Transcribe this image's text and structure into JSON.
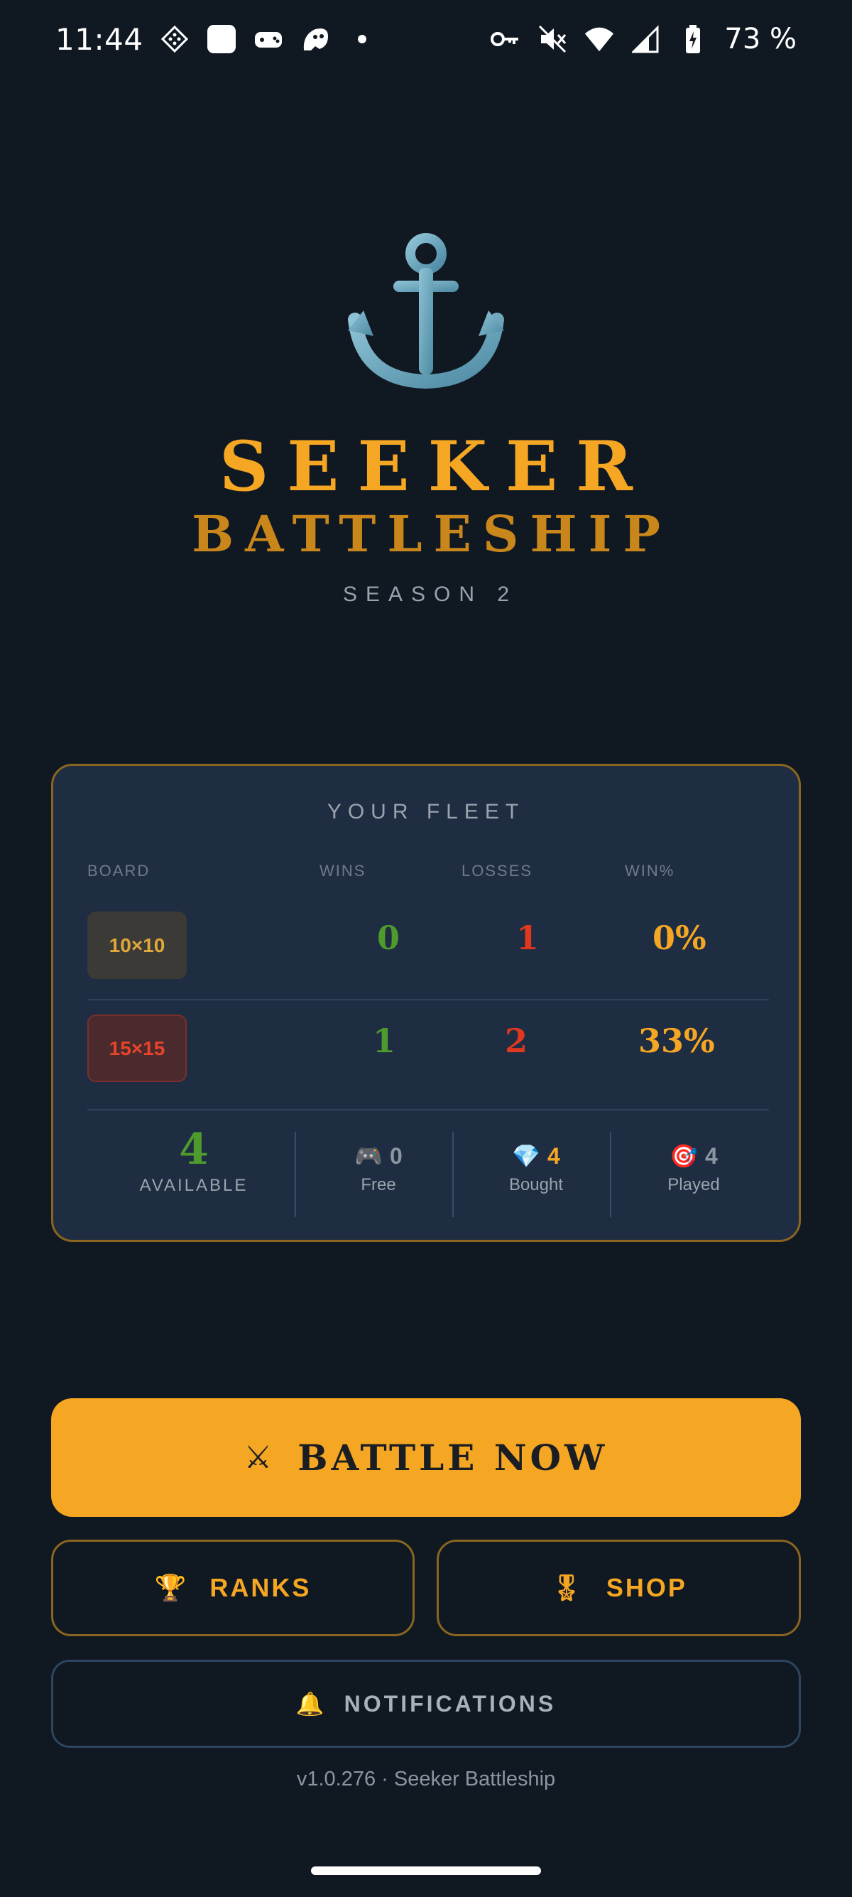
{
  "status_bar": {
    "time": "11:44",
    "battery": "73 %",
    "icons": [
      "diamond-grid-icon",
      "white-square-icon",
      "game-controller-icon",
      "ghost-icon",
      "dot-icon",
      "vpn-key-icon",
      "mute-icon",
      "wifi-icon",
      "signal-icon",
      "battery-icon"
    ]
  },
  "hero": {
    "icon": "anchor-icon",
    "title_line1": "SEEKER",
    "title_line2": "BATTLESHIP",
    "subtitle": "SEASON 2"
  },
  "fleet": {
    "title": "YOUR FLEET",
    "headers": {
      "board": "BOARD",
      "wins": "WINS",
      "losses": "LOSSES",
      "win_pct": "WIN%"
    },
    "rows": [
      {
        "board": "10×10",
        "wins": "0",
        "losses": "1",
        "win_pct": "0%"
      },
      {
        "board": "15×15",
        "wins": "1",
        "losses": "2",
        "win_pct": "33%"
      }
    ],
    "available": {
      "value": "4",
      "label": "AVAILABLE"
    },
    "free": {
      "icon": "🎮",
      "value": "0",
      "label": "Free"
    },
    "bought": {
      "icon": "💎",
      "value": "4",
      "label": "Bought"
    },
    "played": {
      "icon": "🎯",
      "value": "4",
      "label": "Played"
    }
  },
  "actions": {
    "battle": {
      "icon": "⚔",
      "label": "BATTLE NOW"
    },
    "ranks": {
      "icon": "🏆",
      "label": "RANKS"
    },
    "shop": {
      "icon": "🎖",
      "label": "SHOP"
    },
    "notifications": {
      "icon": "🔔",
      "label": "NOTIFICATIONS"
    }
  },
  "footer": {
    "version": "v1.0.276 · Seeker Battleship"
  },
  "colors": {
    "background": "#101822",
    "accent": "#f5a623",
    "card": "#1e2d42",
    "win": "#4e9a2d",
    "loss": "#e0381f"
  }
}
